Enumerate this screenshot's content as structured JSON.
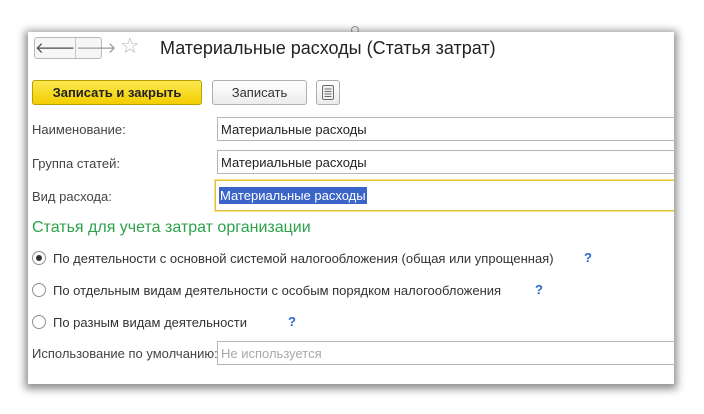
{
  "nav": {
    "back_glyph": "🡐",
    "forward_glyph": "🡒"
  },
  "header": {
    "favorite_glyph": "☆",
    "title": "Материальные расходы (Статья затрат)"
  },
  "toolbar": {
    "save_close_label": "Записать и закрыть",
    "save_label": "Записать"
  },
  "form": {
    "name_label": "Наименование:",
    "name_value": "Материальные расходы",
    "group_label": "Группа статей:",
    "group_value": "Материальные расходы",
    "expense_type_label": "Вид расхода:",
    "expense_type_value": "Материальные расходы"
  },
  "section": {
    "title": "Статья для учета затрат организации",
    "options": [
      {
        "label": "По деятельности с основной системой налогообложения (общая или упрощенная)",
        "selected": true,
        "help": "?"
      },
      {
        "label": "По отдельным видам деятельности с особым порядком налогообложения",
        "selected": false,
        "help": "?"
      },
      {
        "label": "По разным видам деятельности",
        "selected": false,
        "help": "?"
      }
    ]
  },
  "default_use": {
    "label": "Использование по умолчанию:",
    "placeholder": "Не используется"
  },
  "colors": {
    "primary_button": "#f3cd00",
    "section_title": "#2ca24a",
    "help": "#2a67c9",
    "selection": "#3a64c8"
  }
}
